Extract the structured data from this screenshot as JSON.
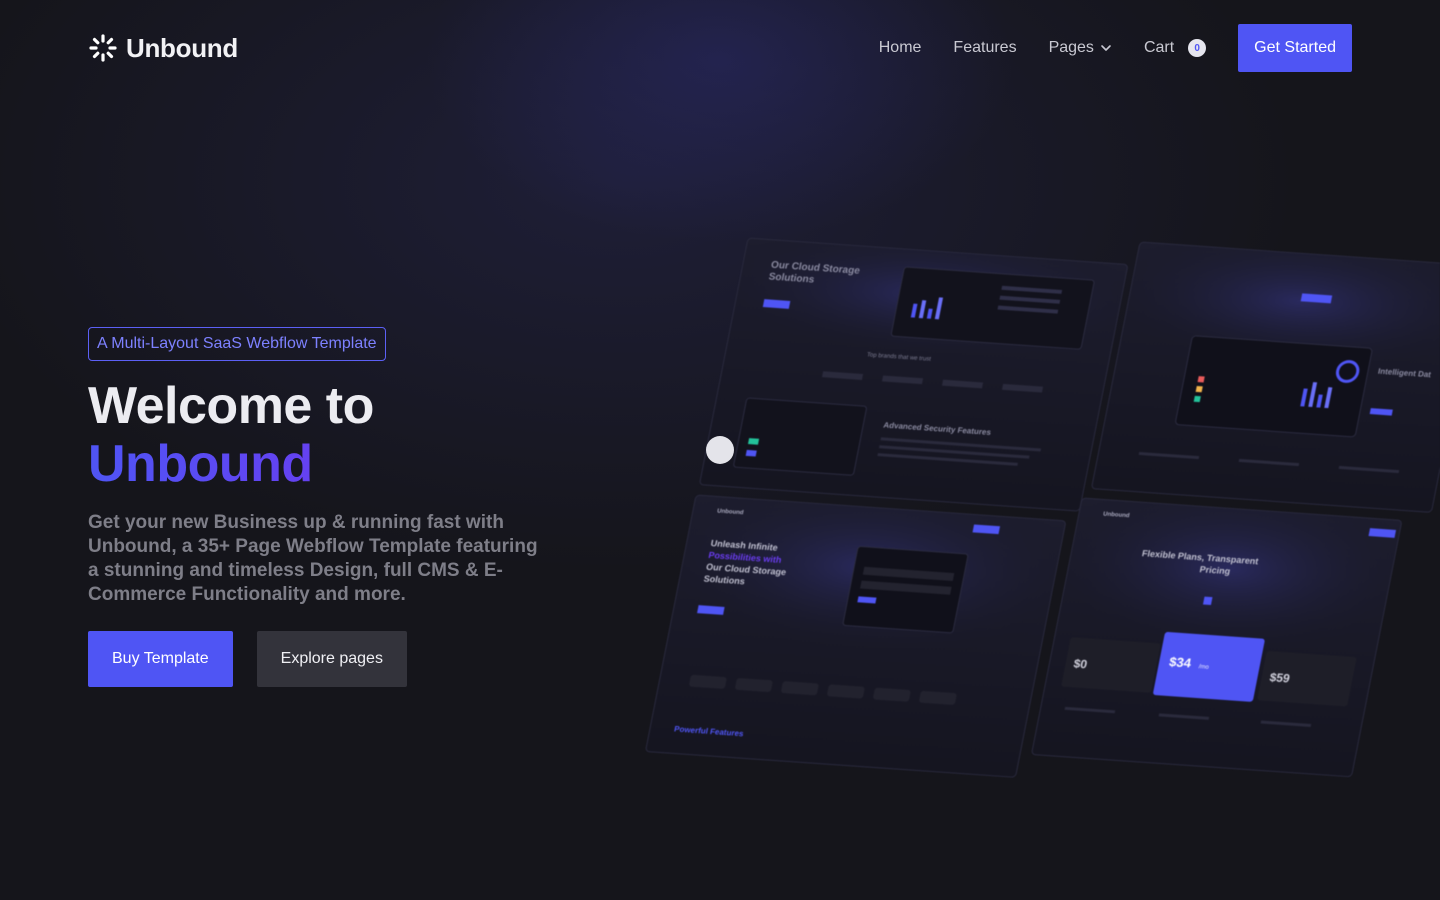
{
  "brand": {
    "name": "Unbound"
  },
  "nav": {
    "links": [
      {
        "label": "Home"
      },
      {
        "label": "Features"
      },
      {
        "label": "Pages"
      },
      {
        "label": "Cart"
      }
    ],
    "cart_count": "0",
    "cta": "Get Started"
  },
  "hero": {
    "tag": "A Multi-Layout SaaS Webflow Template",
    "title_line1": "Welcome to",
    "title_line2": "Unbound",
    "lede": "Get your new Business up & running fast with Unbound, a 35+ Page Webflow Template featuring a stunning and timeless Design, full CMS & E-Commerce Functionality and more.",
    "primary_cta": "Buy Template",
    "secondary_cta": "Explore pages"
  },
  "mockups": {
    "shot1": {
      "title_a": "Our Cloud Storage",
      "title_b": "Solutions",
      "section": "Advanced Security Features"
    },
    "shot2": {
      "heading": "Intelligent Dat"
    },
    "shot3": {
      "brand": "Unbound",
      "head_a": "Unleash Infinite",
      "head_b": "Possibilities with",
      "head_c": "Our Cloud Storage",
      "head_d": "Solutions",
      "footer": "Powerful Features"
    },
    "shot4": {
      "brand": "Unbound",
      "head_a": "Flexible Plans, Transparent",
      "head_b": "Pricing",
      "price1": "$0",
      "price2": "$34",
      "price2_unit": "/mo",
      "price3": "$59"
    }
  },
  "colors": {
    "accent": "#4f55f4",
    "accent_text": "#7d81ff",
    "background": "#15151b",
    "muted": "#7e7e88"
  }
}
